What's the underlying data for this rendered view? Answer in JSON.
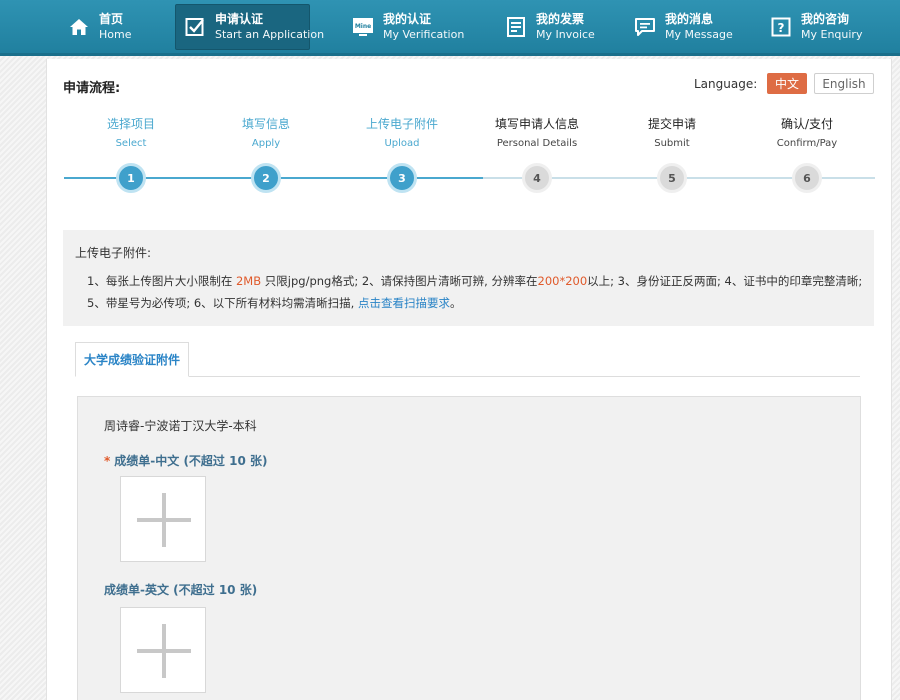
{
  "nav": {
    "items": [
      {
        "cn": "首页",
        "en": "Home",
        "icon": "home-icon",
        "active": false
      },
      {
        "cn": "申请认证",
        "en": "Start an Application",
        "icon": "checkbox-icon",
        "active": true
      },
      {
        "cn": "我的认证",
        "en": "My Verification",
        "icon": "verification-icon",
        "active": false
      },
      {
        "cn": "我的发票",
        "en": "My Invoice",
        "icon": "invoice-icon",
        "active": false
      },
      {
        "cn": "我的消息",
        "en": "My Message",
        "icon": "message-icon",
        "active": false
      },
      {
        "cn": "我的咨询",
        "en": "My Enquiry",
        "icon": "enquiry-icon",
        "active": false
      }
    ],
    "verification_icon_text": "Mine",
    "enquiry_icon_text": "?"
  },
  "process": {
    "title": "申请流程:",
    "language_label": "Language:",
    "lang_cn": "中文",
    "lang_en": "English",
    "steps": [
      {
        "cn": "选择项目",
        "en": "Select",
        "num": "1",
        "done": true
      },
      {
        "cn": "填写信息",
        "en": "Apply",
        "num": "2",
        "done": true
      },
      {
        "cn": "上传电子附件",
        "en": "Upload",
        "num": "3",
        "done": true
      },
      {
        "cn": "填写申请人信息",
        "en": "Personal Details",
        "num": "4",
        "done": false
      },
      {
        "cn": "提交申请",
        "en": "Submit",
        "num": "5",
        "done": false
      },
      {
        "cn": "确认/支付",
        "en": "Confirm/Pay",
        "num": "6",
        "done": false
      }
    ]
  },
  "notice": {
    "title": "上传电子附件:",
    "p1": "1、每张上传图片大小限制在 ",
    "size_limit": "2MB",
    "p2": " 只限jpg/png格式; 2、请保持图片清晰可辨, 分辨率在",
    "resolution": "200*200",
    "p3": "以上; 3、身份证正反两面; 4、证书中的印章完整清晰; 5、带星号为必传项; 6、以下所有材料均需清晰扫描, ",
    "link": "点击查看扫描要求",
    "p4": "。"
  },
  "tab": {
    "label": "大学成绩验证附件"
  },
  "upload": {
    "applicant": "周诗睿-宁波诺丁汉大学-本科",
    "field1": {
      "required_mark": "*",
      "label": "成绩单-中文 (不超过 10 张)"
    },
    "field2": {
      "label": "成绩单-英文 (不超过 10 张)"
    }
  },
  "colors": {
    "nav_bg": "#2288aa",
    "accent": "#3fa0cb",
    "highlight": "#e05a2b",
    "link": "#2a84c6"
  }
}
